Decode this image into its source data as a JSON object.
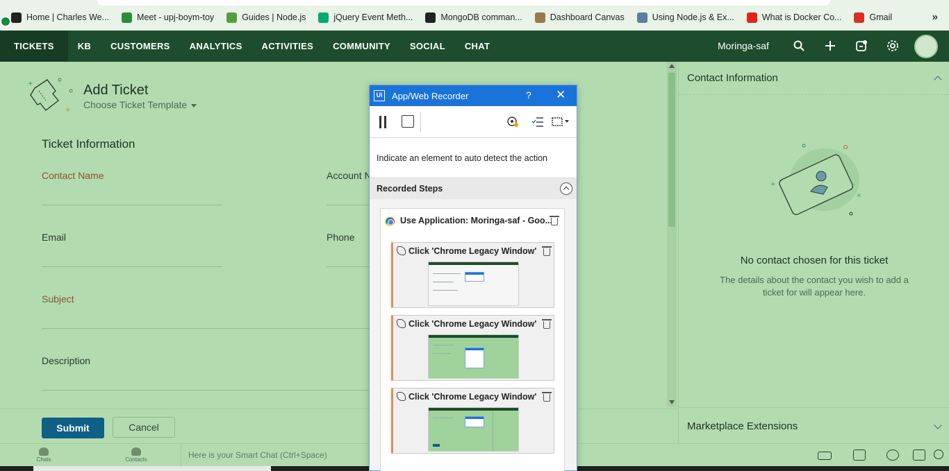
{
  "bookmarks": {
    "items": [
      {
        "label": "Home | Charles We...",
        "icon": "tumblr-like-icon",
        "color": "#222"
      },
      {
        "label": "Meet - upj-boym-toy",
        "icon": "google-meet-icon",
        "color": "#2d8c3c"
      },
      {
        "label": "Guides | Node.js",
        "icon": "nodejs-icon",
        "color": "#539e43"
      },
      {
        "label": "jQuery Event Meth...",
        "icon": "w3schools-icon",
        "color": "#04aa6d"
      },
      {
        "label": "MongoDB comman...",
        "icon": "github-icon",
        "color": "#222"
      },
      {
        "label": "Dashboard Canvas",
        "icon": "canvas-icon",
        "color": "#9a7a4a"
      },
      {
        "label": "Using Node.js & Ex...",
        "icon": "cloudinary-icon",
        "color": "#5a7fa0"
      },
      {
        "label": "What is Docker Co...",
        "icon": "youtube-icon",
        "color": "#e62117"
      },
      {
        "label": "Gmail",
        "icon": "gmail-icon",
        "color": "#d93025"
      }
    ],
    "more": "»"
  },
  "nav": {
    "tabs": [
      "TICKETS",
      "KB",
      "CUSTOMERS",
      "ANALYTICS",
      "ACTIVITIES",
      "COMMUNITY",
      "SOCIAL",
      "CHAT"
    ],
    "active_tab": "TICKETS",
    "org_name": "Moringa-saf"
  },
  "form": {
    "title": "Add Ticket",
    "template_label": "Choose Ticket Template",
    "section_title": "Ticket Information",
    "fields": {
      "contact_name": "Contact Name",
      "account_name": "Account N",
      "email": "Email",
      "phone": "Phone",
      "subject": "Subject",
      "description": "Description"
    },
    "submit": "Submit",
    "cancel": "Cancel"
  },
  "right_panel": {
    "header": "Contact Information",
    "no_contact": "No contact chosen for this ticket",
    "description": "The details about the contact you wish to add a ticket for will appear here.",
    "marketplace": "Marketplace Extensions"
  },
  "bottom_bar": {
    "chats": "Chats",
    "contacts": "Contacts",
    "smart_chat": "Here is your Smart Chat (Ctrl+Space)"
  },
  "recorder": {
    "title": "App/Web Recorder",
    "help": "?",
    "close": "✕",
    "indicate_text": "Indicate an element to auto detect the action",
    "recorded_steps": "Recorded Steps",
    "application": "Use Application: Moringa-saf - Goo...",
    "steps": [
      {
        "label": "Click 'Chrome Legacy Window'",
        "variant": "white"
      },
      {
        "label": "Click 'Chrome Legacy Window'",
        "variant": "green"
      },
      {
        "label": "Click 'Chrome Legacy Window'",
        "variant": "green-split"
      }
    ]
  },
  "colors": {
    "page_bg": "#b2dcb0",
    "nav_bg": "#1d4d2c",
    "submit_bg": "#0f5f86",
    "recorder_title_bg": "#1a73d9",
    "step_accent": "#f08850"
  }
}
